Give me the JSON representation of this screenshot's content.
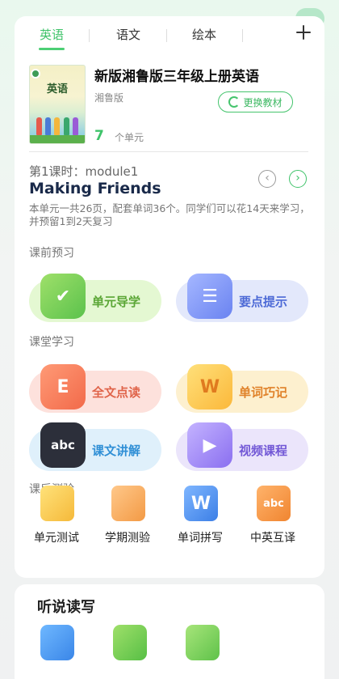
{
  "tabs": [
    {
      "label": "英语",
      "active": true
    },
    {
      "label": "语文",
      "active": false
    },
    {
      "label": "绘本",
      "active": false
    }
  ],
  "book": {
    "cover_title": "英语",
    "title": "新版湘鲁版三年级上册英语",
    "edition": "湘鲁版",
    "change_label": "更换教材",
    "unit_count": "7",
    "unit_label": "个单元"
  },
  "lesson": {
    "number": "第1课时：module1",
    "title": "Making Friends",
    "description": "本单元一共26页，配套单词36个。同学们可以花14天来学习，并预留1到2天复习"
  },
  "sections": {
    "pre_class": "课前预习",
    "in_class": "课堂学习",
    "post_class": "课后测验"
  },
  "pre_class_buttons": [
    {
      "label": "单元导学",
      "icon": "check-book-icon"
    },
    {
      "label": "要点提示",
      "icon": "list-icon"
    }
  ],
  "in_class_buttons": [
    {
      "label": "全文点读",
      "icon": "e-book-microphone-icon"
    },
    {
      "label": "单词巧记",
      "icon": "w-book-pencil-icon"
    },
    {
      "label": "课文讲解",
      "icon": "abc-board-icon"
    },
    {
      "label": "视频课程",
      "icon": "video-camera-icon"
    }
  ],
  "post_class_tools": [
    {
      "label": "单元测试",
      "icon": "exam-paper-icon"
    },
    {
      "label": "学期测验",
      "icon": "document-pencil-icon"
    },
    {
      "label": "单词拼写",
      "icon": "w-spelling-icon"
    },
    {
      "label": "中英互译",
      "icon": "abc-translate-icon"
    }
  ],
  "listen_section": {
    "title": "听说读写"
  },
  "colors": {
    "accent": "#3fc36a"
  }
}
